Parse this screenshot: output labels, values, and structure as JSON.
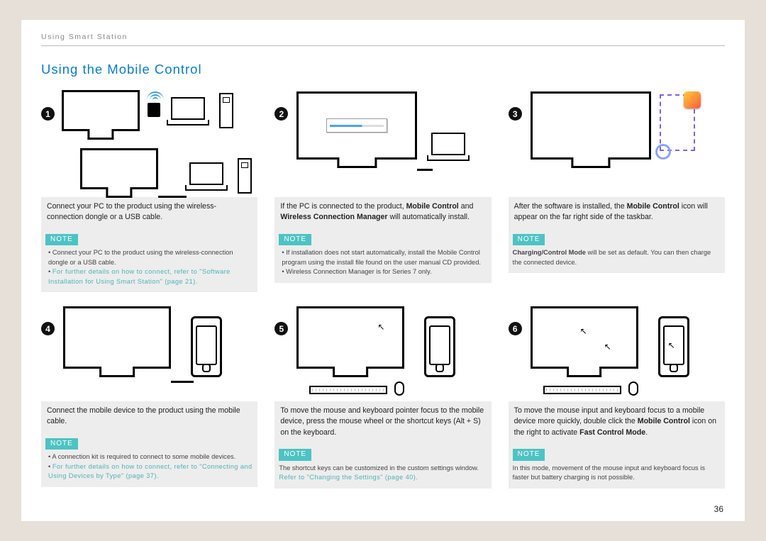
{
  "header": {
    "breadcrumb": "Using Smart Station"
  },
  "title": "Using the Mobile Control",
  "page_number": "36",
  "note_label": "NOTE",
  "steps": [
    {
      "num": "1",
      "caption": "Connect your PC to the product using the wireless-connection dongle or a USB cable.",
      "notes": [
        "Connect your PC to the product using the wireless-connection dongle or a USB cable.",
        "For further details on how to connect, refer to \"Software Installation for Using Smart Station\" (page 21)."
      ],
      "note_link_idx": 1
    },
    {
      "num": "2",
      "caption_html": "If the PC is connected to the product, <b>Mobile Control</b> and <b>Wireless Connection Manager</b> will automatically install.",
      "notes": [
        "If installation does not start automatically, install the Mobile Control program using the install file found on the user manual CD provided.",
        "Wireless Connection Manager is for Series 7 only."
      ]
    },
    {
      "num": "3",
      "caption_html": "After the software is installed, the <b>Mobile Control</b> icon will appear on the far right side of the taskbar.",
      "notes_plain": "Charging/Control Mode will be set as default. You can then charge the connected device.",
      "notes_bold_lead": "Charging/Control Mode"
    },
    {
      "num": "4",
      "caption": "Connect the mobile device to the product using the mobile cable.",
      "notes": [
        "A connection kit is required to connect to some mobile devices.",
        "For further details on how to connect, refer to \"Connecting and Using Devices by Type\" (page 37)."
      ],
      "note_link_idx": 1
    },
    {
      "num": "5",
      "caption": "To move the mouse and keyboard pointer focus to the mobile device, press the mouse wheel or the shortcut keys (Alt + S) on the keyboard.",
      "notes_plain": "The shortcut keys can be customized in the custom settings window.",
      "notes_link_trail": "Refer to \"Changing the Settings\" (page 40)."
    },
    {
      "num": "6",
      "caption_html": "To move the mouse input and keyboard focus to a mobile device more quickly, double click the <b>Mobile Control</b> icon on the right to activate <b>Fast Control Mode</b>.",
      "notes_plain": "In this mode, movement of the mouse input and keyboard focus is faster but battery charging is not possible."
    }
  ]
}
